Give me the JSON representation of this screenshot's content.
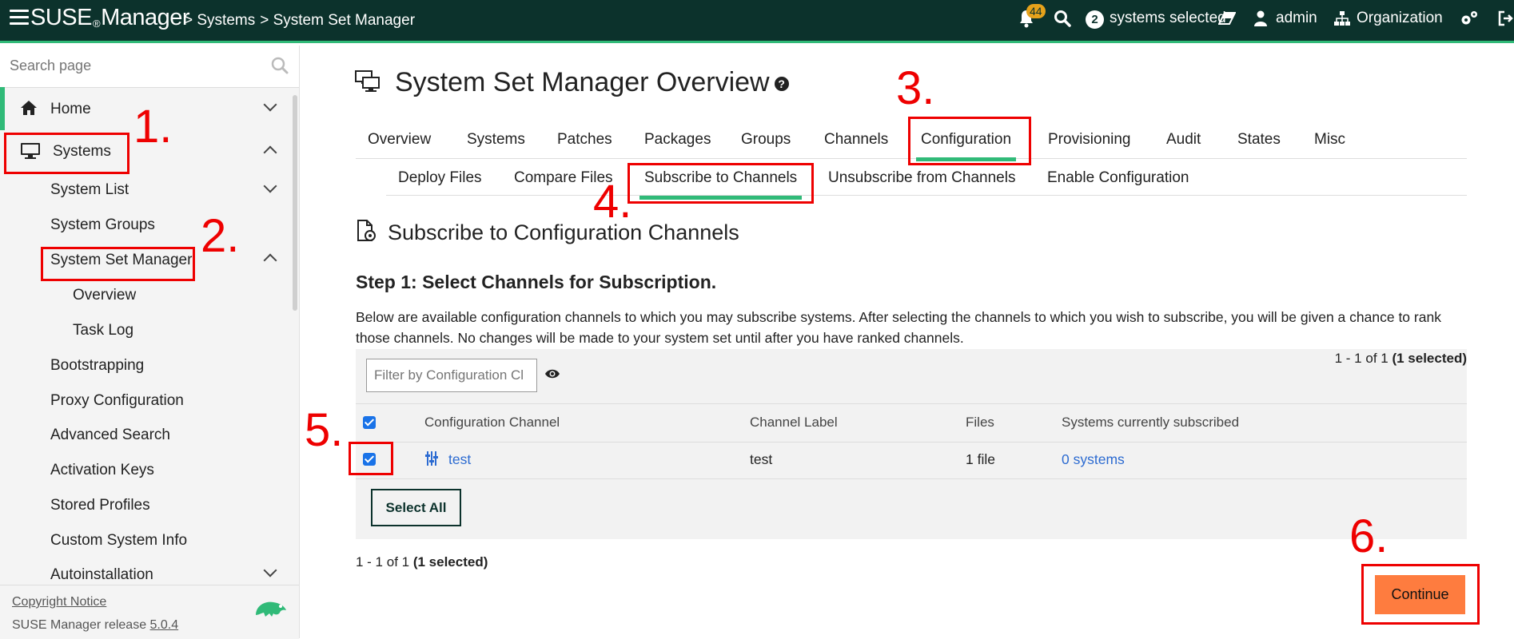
{
  "topbar": {
    "brand_pre": "SUSE",
    "brand_reg": "®",
    "brand_post": "Manager",
    "breadcrumb": [
      "> Systems",
      "> System Set Manager"
    ],
    "notification_count": "44",
    "systems_selected_count": "2",
    "systems_selected_label": "systems selected",
    "user": "admin",
    "org": "Organization"
  },
  "sidebar": {
    "search_placeholder": "Search page",
    "items": [
      {
        "label": "Home"
      },
      {
        "label": "Systems"
      },
      {
        "label": "System List"
      },
      {
        "label": "System Groups"
      },
      {
        "label": "System Set Manager"
      },
      {
        "label": "Overview"
      },
      {
        "label": "Task Log"
      },
      {
        "label": "Bootstrapping"
      },
      {
        "label": "Proxy Configuration"
      },
      {
        "label": "Advanced Search"
      },
      {
        "label": "Activation Keys"
      },
      {
        "label": "Stored Profiles"
      },
      {
        "label": "Custom System Info"
      },
      {
        "label": "Autoinstallation"
      }
    ],
    "copyright": "Copyright Notice",
    "release_prefix": "SUSE Manager release ",
    "release_version": "5.0.4"
  },
  "main": {
    "title": "System Set Manager Overview",
    "help": "?",
    "tabs": [
      "Overview",
      "Systems",
      "Patches",
      "Packages",
      "Groups",
      "Channels",
      "Configuration",
      "Provisioning",
      "Audit",
      "States",
      "Misc"
    ],
    "active_tab": "Configuration",
    "subtabs": [
      "Deploy Files",
      "Compare Files",
      "Subscribe to Channels",
      "Unsubscribe from Channels",
      "Enable Configuration"
    ],
    "active_subtab": "Subscribe to Channels",
    "section_title": "Subscribe to Configuration Channels",
    "step_title": "Step 1: Select Channels for Subscription.",
    "description": "Below are available configuration channels to which you may subscribe systems. After selecting the channels to which you wish to subscribe, you will be given a chance to rank those channels. No changes will be made to your system set until after you have ranked channels.",
    "count_prefix": "1 - 1 of 1 ",
    "count_selected": "(1 selected)",
    "filter_placeholder": "Filter by Configuration Cl",
    "columns": [
      "Configuration Channel",
      "Channel Label",
      "Files",
      "Systems currently subscribed"
    ],
    "rows": [
      {
        "channel": "test",
        "label": "test",
        "files": "1 file",
        "systems": "0 systems",
        "checked": true
      }
    ],
    "select_all": "Select All",
    "continue": "Continue"
  },
  "annotations": [
    "1.",
    "2.",
    "3.",
    "4.",
    "5.",
    "6."
  ],
  "colors": {
    "topbar": "#0c322c",
    "accent_green": "#30ba78",
    "continue_orange": "#fe7c3f",
    "annotation_red": "#ee0000",
    "link": "#2c6bd1"
  }
}
